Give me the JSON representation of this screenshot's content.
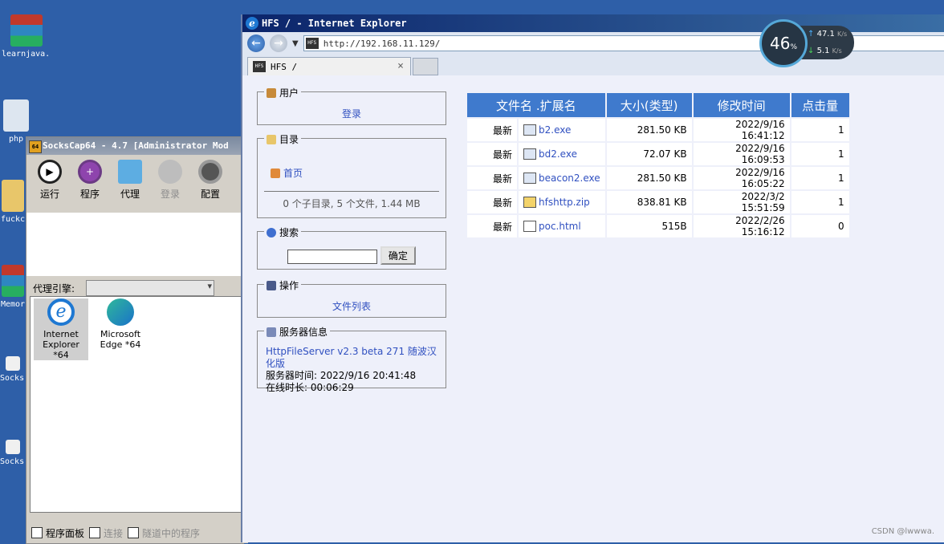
{
  "desktop": {
    "icons": [
      {
        "label": "learnjava...",
        "color": "#c0392b"
      },
      {
        "label": "php",
        "color": "#dde6f0"
      },
      {
        "label": "fuckc",
        "color": "#e8c66a"
      },
      {
        "label": "Memor",
        "color": "#c0392b"
      },
      {
        "label": "Socks User",
        "color": "#f0f0f0"
      },
      {
        "label": "Socks Mo",
        "color": "#f0f0f0"
      }
    ]
  },
  "sockscap": {
    "title": "SocksCap64 - 4.7 [Administrator Mod",
    "logo_text": "64",
    "toolbar": {
      "run": "运行",
      "program": "程序",
      "proxy": "代理",
      "login": "登录",
      "config": "配置"
    },
    "proxy_engine_label": "代理引擎:",
    "programs": [
      {
        "label": "Internet Explorer *64"
      },
      {
        "label": "Microsoft Edge *64"
      }
    ],
    "tabs": {
      "program_panel": "程序面板",
      "connection": "连接",
      "tunneled": "隧道中的程序"
    }
  },
  "ie": {
    "title": "HFS / - Internet Explorer",
    "address": "http://192.168.11.129/",
    "tab_title": "HFS /",
    "tab_close": "×",
    "favicon_text": "HFS"
  },
  "hfs": {
    "user": {
      "title": "用户",
      "login": "登录"
    },
    "dir": {
      "title": "目录",
      "home": "首页",
      "summary": "0 个子目录, 5 个文件, 1.44 MB"
    },
    "search": {
      "title": "搜索",
      "button": "确定"
    },
    "actions": {
      "title": "操作",
      "file_list": "文件列表"
    },
    "server": {
      "title": "服务器信息",
      "version": "HttpFileServer v2.3 beta 271 随波汉化版",
      "time": "服务器时间: 2022/9/16 20:41:48",
      "uptime": "在线时长: 00:06:29"
    },
    "table": {
      "headers": [
        "文件名 .扩展名",
        "大小(类型)",
        "修改时间",
        "点击量"
      ],
      "rows": [
        {
          "new": "最新",
          "name": "b2.exe",
          "size": "281.50 KB",
          "date": "2022/9/16 16:41:12",
          "hits": "1",
          "icon": "exe"
        },
        {
          "new": "最新",
          "name": "bd2.exe",
          "size": "72.07 KB",
          "date": "2022/9/16 16:09:53",
          "hits": "1",
          "icon": "exe"
        },
        {
          "new": "最新",
          "name": "beacon2.exe",
          "size": "281.50 KB",
          "date": "2022/9/16 16:05:22",
          "hits": "1",
          "icon": "exe"
        },
        {
          "new": "最新",
          "name": "hfshttp.zip",
          "size": "838.81 KB",
          "date": "2022/3/2 15:51:59",
          "hits": "1",
          "icon": "zip"
        },
        {
          "new": "最新",
          "name": "poc.html",
          "size": "515B",
          "date": "2022/2/26 15:16:12",
          "hits": "0",
          "icon": "html"
        }
      ]
    }
  },
  "network": {
    "percent": "46",
    "percent_unit": "%",
    "up": "47.1",
    "down": "5.1",
    "unit": "K/s"
  },
  "watermark": "CSDN @lwwwa."
}
